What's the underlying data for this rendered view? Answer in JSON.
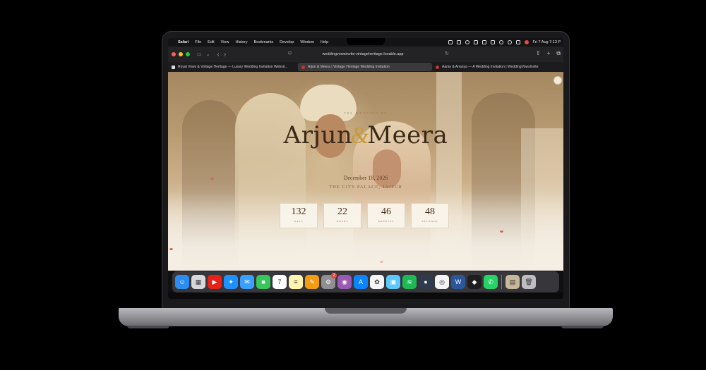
{
  "menubar": {
    "apple": "",
    "app_name": "Safari",
    "menus": [
      "File",
      "Edit",
      "View",
      "History",
      "Bookmarks",
      "Develop",
      "Window",
      "Help"
    ],
    "datetime": "Fri 7 Aug  7:13 P"
  },
  "toolbar": {
    "url": "weddingvowsinvite-vintageheritage.lovable.app",
    "back_glyph": "‹",
    "forward_glyph": "›",
    "share_glyph": "⇧",
    "newtab_glyph": "+",
    "tabs_glyph": "⧉"
  },
  "tabs": [
    {
      "title": "Royal Vows & Vintage Heritage — Luxury Wedding Invitation Websit...",
      "active": false
    },
    {
      "title": "Arjun & Meera | Vintage Heritage Wedding Invitation",
      "active": true
    },
    {
      "title": "Aarav & Ananya — A Wedding Invitation | WeddingVowsInvite",
      "active": false
    }
  ],
  "hero": {
    "pre_title": "THE WEDDING OF",
    "groom": "Arjun",
    "ampersand": "&",
    "bride": "Meera",
    "date": "December 18, 2026",
    "venue": "THE CITY PALACE, JAIPUR"
  },
  "countdown": [
    {
      "value": "132",
      "label": "DAYS"
    },
    {
      "value": "22",
      "label": "HOURS"
    },
    {
      "value": "46",
      "label": "MINUTES"
    },
    {
      "value": "48",
      "label": "SECONDS"
    }
  ],
  "dock": {
    "apps": [
      {
        "name": "finder",
        "color": "#2d8cf0",
        "glyph": "☺"
      },
      {
        "name": "launchpad",
        "color": "#d8d8dc",
        "glyph": "▦"
      },
      {
        "name": "youtube",
        "color": "#e62117",
        "glyph": "▶"
      },
      {
        "name": "safari",
        "color": "#1e90ff",
        "glyph": "✦"
      },
      {
        "name": "mail",
        "color": "#3aa0ff",
        "glyph": "✉"
      },
      {
        "name": "facetime",
        "color": "#34c759",
        "glyph": "■"
      },
      {
        "name": "calendar",
        "color": "#ffffff",
        "glyph": "7"
      },
      {
        "name": "notes",
        "color": "#fff3b0",
        "glyph": "≡"
      },
      {
        "name": "pages",
        "color": "#f39c12",
        "glyph": "✎"
      },
      {
        "name": "system-settings",
        "color": "#8e8e93",
        "glyph": "⚙",
        "badge": "2"
      },
      {
        "name": "podcasts",
        "color": "#9b59b6",
        "glyph": "◉"
      },
      {
        "name": "app-store",
        "color": "#0a84ff",
        "glyph": "A"
      },
      {
        "name": "photos",
        "color": "#f5f5f5",
        "glyph": "✿"
      },
      {
        "name": "preview",
        "color": "#5ac8fa",
        "glyph": "▣"
      },
      {
        "name": "spotify",
        "color": "#1db954",
        "glyph": "≋"
      },
      {
        "name": "utility",
        "color": "#2f3b4c",
        "glyph": "●"
      },
      {
        "name": "chrome",
        "color": "#f4f4f4",
        "glyph": "◎"
      },
      {
        "name": "word",
        "color": "#2b579a",
        "glyph": "W"
      },
      {
        "name": "figma",
        "color": "#1e1e1e",
        "glyph": "◆"
      },
      {
        "name": "whatsapp",
        "color": "#25d366",
        "glyph": "✆"
      }
    ],
    "trailing": [
      {
        "name": "downloads-stack",
        "color": "#c9b79a",
        "glyph": "▤"
      },
      {
        "name": "trash",
        "color": "#bdbdc2",
        "glyph": "🗑"
      }
    ]
  }
}
